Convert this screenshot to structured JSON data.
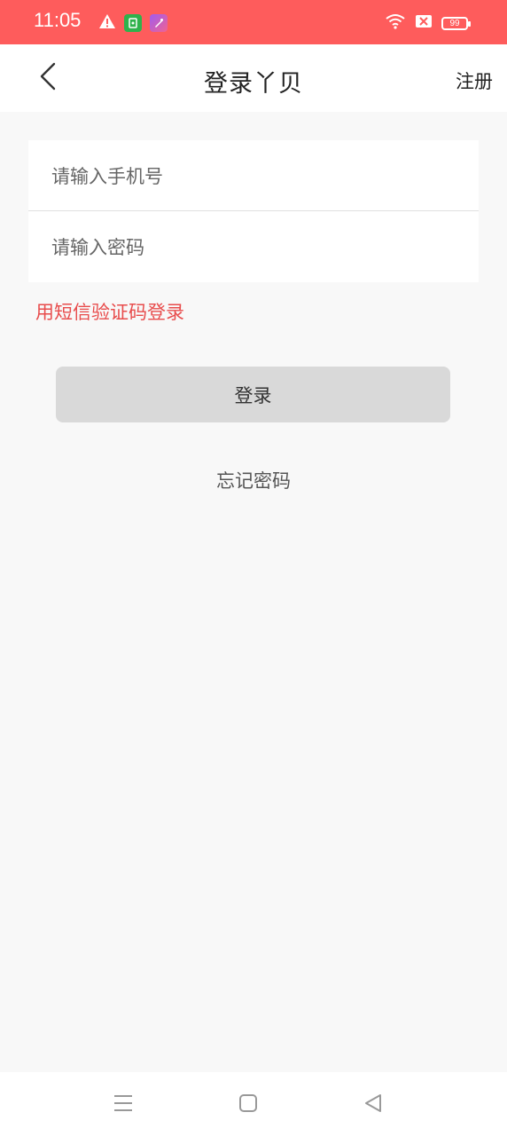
{
  "status_bar": {
    "time": "11:05",
    "battery": "99",
    "left_icons": [
      "warning-icon",
      "app-green-icon",
      "app-purple-icon"
    ],
    "right_icons": [
      "wifi-icon",
      "sim-x-icon",
      "battery-icon"
    ],
    "colors": {
      "background": "#fe5c5c"
    }
  },
  "header": {
    "title": "登录丫贝",
    "register_label": "注册",
    "back_icon": "chevron-left-icon"
  },
  "form": {
    "phone_placeholder": "请输入手机号",
    "phone_value": "",
    "password_placeholder": "请输入密码",
    "password_value": ""
  },
  "sms_login_label": "用短信验证码登录",
  "login_button_label": "登录",
  "forgot_password_label": "忘记密码",
  "colors": {
    "accent_red": "#e84c4c",
    "button_disabled": "#d9d9d9",
    "page_background": "#f8f8f8"
  },
  "system_nav": {
    "icons": [
      "menu-icon",
      "home-icon",
      "back-triangle-icon"
    ]
  }
}
